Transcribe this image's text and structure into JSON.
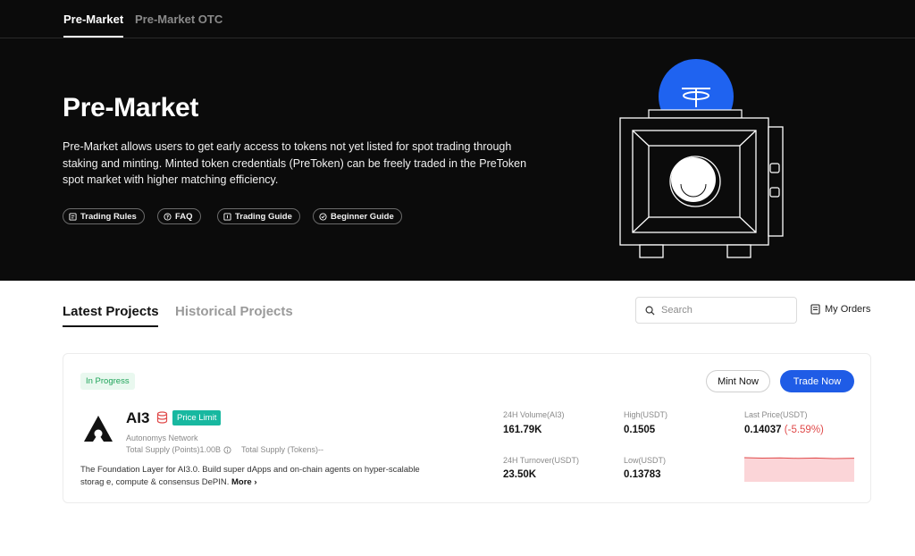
{
  "tabs": [
    {
      "label": "Pre-Market",
      "active": true
    },
    {
      "label": "Pre-Market OTC",
      "active": false
    }
  ],
  "hero": {
    "title": "Pre-Market",
    "description": "Pre-Market allows users to get early access to tokens not yet listed for spot trading through staking and minting. Minted token credentials (PreToken) can be freely traded in the PreToken spot market with higher matching efficiency.",
    "links": [
      {
        "label": "Trading Rules",
        "icon": "document-icon"
      },
      {
        "label": "FAQ",
        "icon": "question-icon"
      },
      {
        "label": "Trading Guide",
        "icon": "guide-icon"
      },
      {
        "label": "Beginner Guide",
        "icon": "compass-icon"
      }
    ]
  },
  "projects_nav": {
    "tabs": [
      {
        "label": "Latest Projects",
        "active": true
      },
      {
        "label": "Historical Projects",
        "active": false
      }
    ],
    "search_placeholder": "Search",
    "my_orders": "My Orders"
  },
  "project": {
    "status": "In Progress",
    "name": "AI3",
    "tag": "Price Limit",
    "network": "Autonomys Network",
    "total_supply_points": "Total Supply (Points)1.00B",
    "total_supply_tokens": "Total Supply (Tokens)--",
    "description": "The Foundation Layer for AI3.0. Build super dApps and on-chain agents on hyper-scalable storag e, compute & consensus DePIN.",
    "more_label": "More",
    "mint_label": "Mint Now",
    "trade_label": "Trade Now",
    "stats": {
      "volume_label": "24H Volume(AI3)",
      "volume": "161.79K",
      "high_label": "High(USDT)",
      "high": "0.1505",
      "last_label": "Last Price(USDT)",
      "last": "0.14037",
      "change": "(-5.59%)",
      "turnover_label": "24H Turnover(USDT)",
      "turnover": "23.50K",
      "low_label": "Low(USDT)",
      "low": "0.13783"
    }
  },
  "colors": {
    "hero_bg": "#0b0b0b",
    "accent_blue": "#1f5ce6",
    "tag_teal": "#18b8a0",
    "negative_red": "#e04a4a",
    "progress_green": "#1fa35a",
    "sparkline_fill": "#fbd5d8",
    "sparkline_line": "#e04a4a"
  }
}
